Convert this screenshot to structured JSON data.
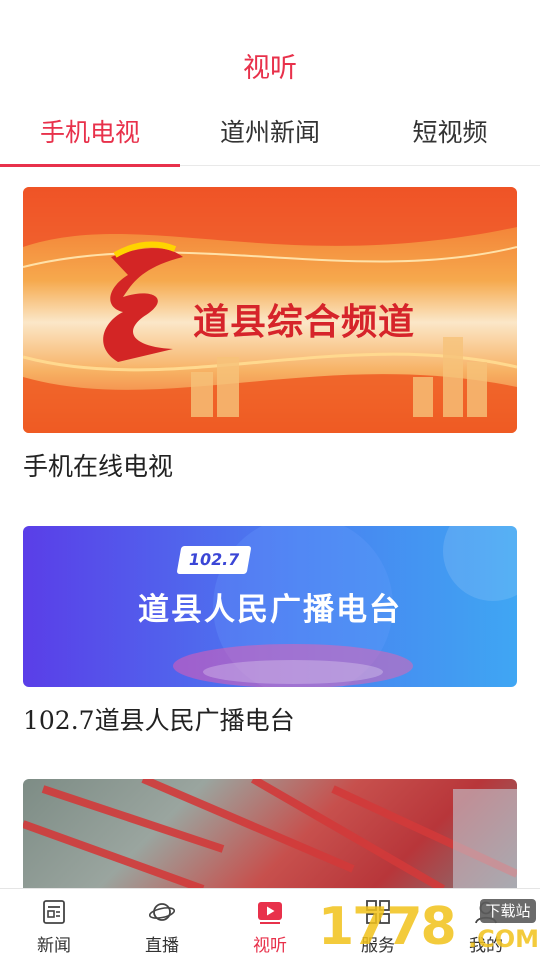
{
  "header": {
    "title": "视听"
  },
  "tabs": [
    {
      "label": "手机电视",
      "active": true
    },
    {
      "label": "道州新闻",
      "active": false
    },
    {
      "label": "短视频",
      "active": false
    }
  ],
  "cards": [
    {
      "banner_text": "道县综合频道",
      "caption": "手机在线电视"
    },
    {
      "banner_badge": "102.7",
      "banner_text": "道县人民广播电台",
      "caption": "102.7道县人民广播电台"
    },
    {
      "caption": ""
    }
  ],
  "tabbar": [
    {
      "label": "新闻",
      "icon": "news-icon",
      "active": false
    },
    {
      "label": "直播",
      "icon": "live-planet-icon",
      "active": false
    },
    {
      "label": "视听",
      "icon": "play-video-icon",
      "active": true
    },
    {
      "label": "服务",
      "icon": "grid-service-icon",
      "active": false
    },
    {
      "label": "我的",
      "icon": "user-icon",
      "active": false
    }
  ],
  "watermark": {
    "text": "1778",
    "badge": "下载站",
    "suffix": ".COM"
  },
  "colors": {
    "accent": "#e8314b",
    "text": "#222222",
    "divider": "#e9e9e9"
  }
}
